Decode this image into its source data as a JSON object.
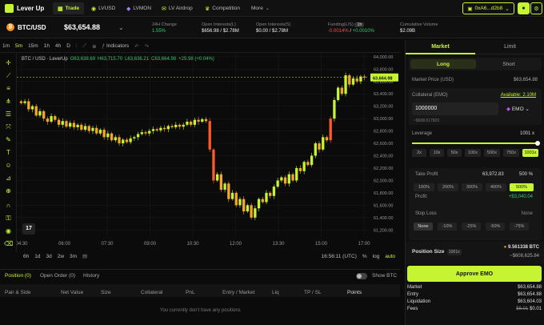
{
  "nav": {
    "logo": "Lever Up",
    "tabs": [
      {
        "label": "Trade",
        "icon": "chart-icon"
      },
      {
        "label": "LVUSD",
        "icon": "coin-icon"
      },
      {
        "label": "LVMON",
        "icon": "diamond-icon"
      },
      {
        "label": "LV Airdrop",
        "icon": "gift-icon"
      },
      {
        "label": "Competition",
        "icon": "trophy-icon"
      },
      {
        "label": "More",
        "icon": "chevron-down-icon"
      }
    ],
    "wallet": "0xA6...d2b8"
  },
  "ticker": {
    "pair": "BTC/USD",
    "price": "$63,654.88",
    "stats": [
      {
        "label": "24H Change",
        "value": "1.55%"
      },
      {
        "label": "Open Interests(L)",
        "value": "$656.98 / $2.78M"
      },
      {
        "label": "Open Interests(S)",
        "value": "$0.00 / $2.78M"
      },
      {
        "label": "Funding(L/S)",
        "badge": "1h",
        "long": "-0.0014%",
        "short": "+0.0010%"
      },
      {
        "label": "Cumulative Volume",
        "value": "$2.09B"
      }
    ]
  },
  "chart_toolbar": {
    "intervals": [
      "1m",
      "5m",
      "15m",
      "1h",
      "4h",
      "D"
    ],
    "selected": "5m",
    "indicators": "Indicators"
  },
  "chart_header": {
    "title": "BTC / USD · LeverUp",
    "o": "O63,638.69",
    "h": "H63,715.70",
    "l": "L63,636.21",
    "c": "C63,664.98",
    "chg": "+25.98 (+0.04%)"
  },
  "chart_data": {
    "type": "candlestick",
    "x_ticks": [
      "04:30",
      "06:00",
      "07:30",
      "09:00",
      "10:30",
      "12:00",
      "13:30",
      "15:00",
      "17:00"
    ],
    "y_ticks": [
      64000,
      63800,
      63600,
      63400,
      63200,
      63000,
      62800,
      62600,
      62400,
      62200,
      62000,
      61800,
      61600,
      61400,
      61200
    ],
    "ylim": [
      61100,
      64050
    ],
    "last_price_label": "63,664.98",
    "last_price": 63665,
    "close": [
      63250,
      63280,
      63150,
      63200,
      63050,
      63120,
      63000,
      62950,
      63040,
      62980,
      62900,
      62960,
      62870,
      62930,
      62860,
      62900,
      62820,
      62880,
      62800,
      62850,
      62760,
      62820,
      62700,
      62760,
      62650,
      62700,
      62600,
      62660,
      62620,
      62680,
      62700,
      62750,
      62780,
      62760,
      62800,
      62830,
      62810,
      62850,
      62830,
      62880,
      62860,
      62900,
      62870,
      62900,
      62950,
      62900,
      62980,
      62950,
      62990,
      62960,
      62500,
      62000,
      62100,
      61850,
      61950,
      61700,
      61800,
      61600,
      61700,
      61500,
      61600,
      61400,
      61550,
      61700,
      61650,
      61800,
      61750,
      61900,
      62000,
      62050,
      61950,
      62100,
      62000,
      62200,
      62150,
      62300,
      62250,
      62400,
      62600,
      62500,
      62700,
      62650,
      63000,
      63300,
      63500,
      63400,
      63700,
      63550,
      63650,
      63600,
      63680,
      63665
    ],
    "candle_count": 92
  },
  "chart_bottom": {
    "ranges": [
      "6h",
      "1d",
      "3d",
      "2w",
      "3m"
    ],
    "time": "16:56:11 (UTC)",
    "pct": "%",
    "log": "log",
    "auto": "auto"
  },
  "positions": {
    "tabs": [
      "Position (0)",
      "Open Order (0)",
      "History"
    ],
    "show_btc": "Show BTC",
    "columns": [
      "Pair & Side",
      "Net Value",
      "Size",
      "Collateral",
      "PnL",
      "Entry / Market",
      "Liq",
      "TP / SL",
      "Points"
    ],
    "empty": "You currently don't have any positions"
  },
  "panel": {
    "tabs": [
      "Market",
      "Limit"
    ],
    "sides": [
      "Long",
      "Short"
    ],
    "market_price_label": "Market Price (USD)",
    "market_price": "$63,654.88",
    "collateral_label": "Collateral (EMO)",
    "available": "Available: 2.10M",
    "collateral_value": "1000000",
    "collateral_unit": "EMO",
    "collateral_usd": "~$608.617820",
    "leverage_label": "Leverage",
    "leverage_value": "1001 x",
    "leverage_chips": [
      "2x",
      "10x",
      "50x",
      "100x",
      "500x",
      "750x",
      "1001x"
    ],
    "take_profit_label": "Take Profit",
    "tp_price": "63,972.83",
    "tp_pct": "500 %",
    "tp_chips": [
      "100%",
      "200%",
      "300%",
      "400%",
      "500%"
    ],
    "profit_label": "Profit:",
    "profit_value": "+$3,040.04",
    "stop_loss_label": "Stop Loss",
    "sl_value": "None",
    "sl_chips": [
      "None",
      "-10%",
      "-25%",
      "-50%",
      "-75%"
    ],
    "size_label": "Position Size",
    "size_badge": "1001x",
    "size_btc": "9.561338 BTC",
    "size_usd": "~$608,625.84",
    "approve": "Approve EMO",
    "summary": [
      {
        "label": "Market",
        "value": "$63,654.88"
      },
      {
        "label": "Entry",
        "value": "$63,654.88"
      },
      {
        "label": "Liquidation",
        "value": "$63,604.03"
      }
    ],
    "fees_label": "Fees",
    "fees_old": "$6.01",
    "fees_new": "$0.01"
  }
}
